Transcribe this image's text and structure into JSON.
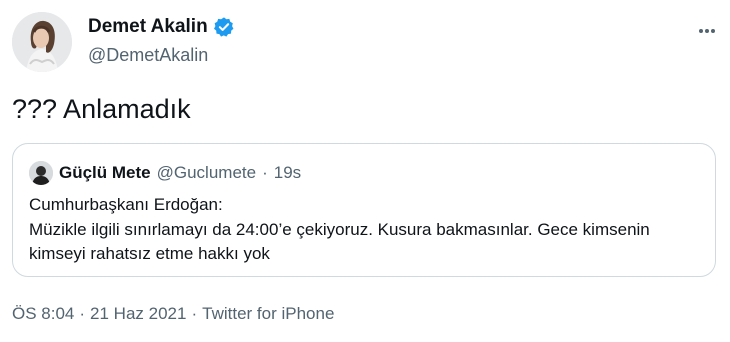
{
  "author": {
    "display_name": "Demet Akalin",
    "handle": "@DemetAkalin"
  },
  "tweet": {
    "text": "??? Anlamadık"
  },
  "quoted_tweet": {
    "display_name": "Güçlü Mete",
    "handle": "@Guclumete",
    "separator": "·",
    "time": "19s",
    "lines": [
      "Cumhurbaşkanı Erdoğan:",
      "Müzikle ilgili sınırlamayı da 24:00’e çekiyoruz. Kusura bakmasınlar. Gece kimsenin",
      "kimseyi rahatsız etme hakkı yok"
    ]
  },
  "footer": {
    "time": "ÖS 8:04",
    "sep1": "·",
    "date": "21 Haz 2021",
    "sep2": "·",
    "source": "Twitter for iPhone"
  },
  "icons": {
    "verified": "verified-badge-icon",
    "more": "more-options-icon"
  },
  "colors": {
    "verified_blue": "#1d9bf0",
    "secondary_text": "#536471",
    "border": "#cfd9de"
  }
}
